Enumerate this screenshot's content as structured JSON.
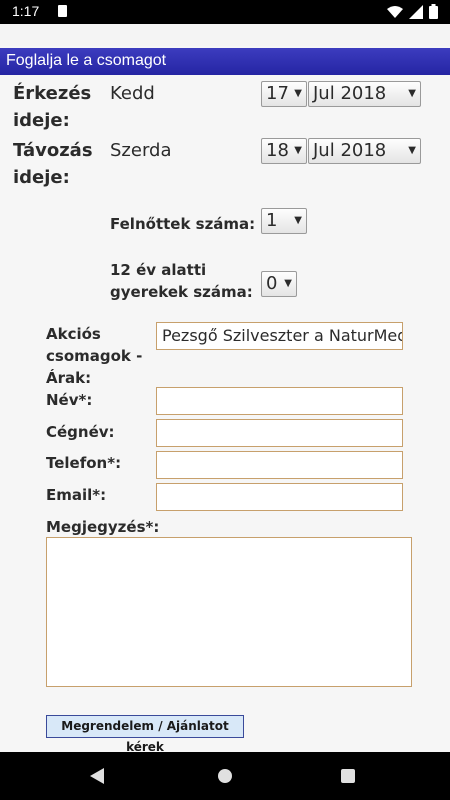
{
  "status": {
    "time": "1:17"
  },
  "header": {
    "title": "Foglalja le a csomagot"
  },
  "arrival": {
    "label1": "Érkezés",
    "label2": "ideje:",
    "day": "Kedd",
    "date": "17",
    "month": "Jul 2018"
  },
  "departure": {
    "label1": "Távozás",
    "label2": "ideje:",
    "day": "Szerda",
    "date": "18",
    "month": "Jul 2018"
  },
  "adults": {
    "label": "Felnőttek száma:",
    "value": "1"
  },
  "children": {
    "label1": "12 év alatti",
    "label2": "gyerekek száma:",
    "value": "0"
  },
  "package": {
    "label1": "Akciós",
    "label2": "csomagok -",
    "label3": "Árak:",
    "value": "Pezsgő Szilveszter a NaturMed"
  },
  "name": {
    "label": "Név*:",
    "value": ""
  },
  "company": {
    "label": "Cégnév:",
    "value": ""
  },
  "phone": {
    "label": "Telefon*:",
    "value": ""
  },
  "email": {
    "label": "Email*:",
    "value": ""
  },
  "comment": {
    "label": "Megjegyzés*:",
    "value": ""
  },
  "submit": {
    "label": "Megrendelem / Ajánlatot kérek"
  }
}
